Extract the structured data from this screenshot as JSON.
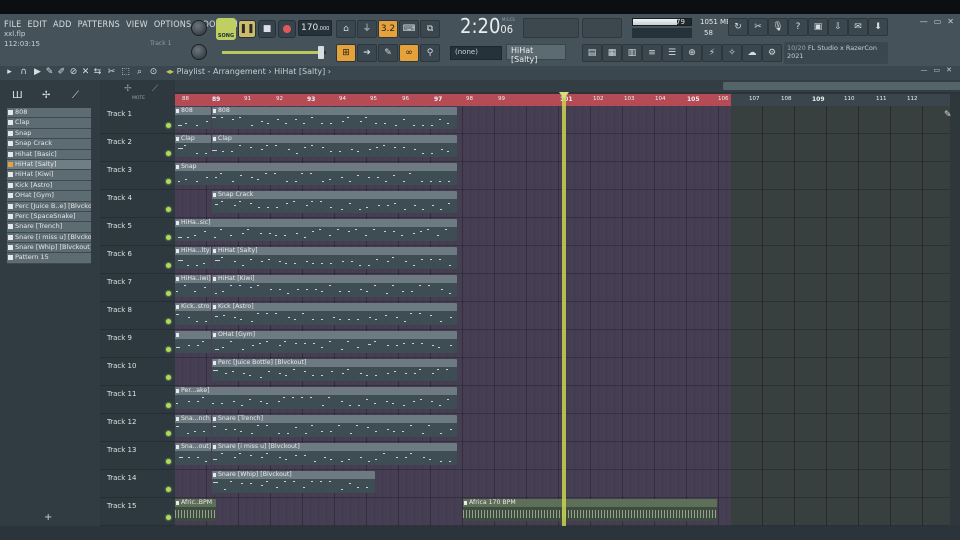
{
  "menu": [
    "FILE",
    "EDIT",
    "ADD",
    "PATTERNS",
    "VIEW",
    "OPTIONS",
    "TOOLS",
    "HELP"
  ],
  "project": {
    "filename": "xxl.flp",
    "time": "112:03:15",
    "hint": "Track 1"
  },
  "transport": {
    "mode": "SONG",
    "tempo": "170",
    "tempo_decimals": ".000",
    "time_main": "2:20",
    "time_sub": "06",
    "time_unit": "M:S:CS",
    "step": "3.2"
  },
  "monitor": {
    "cpu": "79",
    "memory": "1051 MB",
    "voices": "58",
    "cpu_level": 0.75
  },
  "news": {
    "count": "10/20",
    "title": "FL Studio x RazerCon",
    "year": "2021"
  },
  "toolbar": {
    "snap": "(none)",
    "pattern": "HiHat [Salty]"
  },
  "playlist": {
    "title": "Playlist - Arrangement",
    "pattern": "HiHat [Salty]",
    "snap_label": "MOTE"
  },
  "patterns": [
    "808",
    "Clap",
    "Snap",
    "Snap Crack",
    "Hihat [Basic]",
    "HiHat [Salty]",
    "HiHat [Kiwi]",
    "Kick [Astro]",
    "OHat [Gym]",
    "Perc [Juice B..e] [Blvckout]",
    "Perc [SpaceSnake]",
    "Snare [Trench]",
    "Snare [i miss u] [Blvckout]",
    "Snare [Whip] [Blvckout]",
    "Pattern 15"
  ],
  "selected_pattern": 5,
  "tracks": [
    "Track 1",
    "Track 2",
    "Track 3",
    "Track 4",
    "Track 5",
    "Track 6",
    "Track 7",
    "Track 8",
    "Track 9",
    "Track 10",
    "Track 11",
    "Track 12",
    "Track 13",
    "Track 14",
    "Track 15"
  ],
  "bars": [
    "88",
    "89",
    "91",
    "92",
    "93",
    "94",
    "95",
    "96",
    "97",
    "98",
    "99",
    "",
    "101",
    "102",
    "103",
    "104",
    "105",
    "106",
    "107",
    "108",
    "109",
    "110",
    "111",
    "112"
  ],
  "clips": [
    {
      "track": 0,
      "label": "808",
      "type": "pattern",
      "start": 0,
      "len": 36
    },
    {
      "track": 0,
      "label": "808",
      "type": "pattern",
      "start": 36,
      "len": 36
    },
    {
      "track": 0,
      "label": "808",
      "type": "pattern",
      "start": 72,
      "len": 36
    },
    {
      "track": 1,
      "label": "Clap",
      "type": "pattern",
      "start": 0,
      "len": 36
    },
    {
      "track": 1,
      "label": "Clap",
      "type": "pattern",
      "start": 36,
      "len": 36
    },
    {
      "track": 2,
      "label": "Snap",
      "type": "pattern",
      "start": 0,
      "len": 36
    },
    {
      "track": 3,
      "label": "Snap Crack",
      "type": "pattern",
      "start": 36,
      "len": 36
    },
    {
      "track": 3,
      "label": "Snap Crack",
      "type": "pattern",
      "start": 72,
      "len": 36
    },
    {
      "track": 4,
      "label": "HiHa..sic]",
      "type": "pattern",
      "start": 0,
      "len": 36
    },
    {
      "track": 5,
      "label": "HiHa...lty]",
      "type": "pattern",
      "start": 0,
      "len": 36
    },
    {
      "track": 5,
      "label": "HiHat [Salty]",
      "type": "pattern",
      "start": 36,
      "len": 36
    },
    {
      "track": 5,
      "label": "HiHat [Salty]",
      "type": "pattern",
      "start": 72,
      "len": 36
    },
    {
      "track": 6,
      "label": "HiHa..iwi]",
      "type": "pattern",
      "start": 0,
      "len": 36
    },
    {
      "track": 6,
      "label": "HiHat [Kiwi]",
      "type": "pattern",
      "start": 36,
      "len": 36
    },
    {
      "track": 6,
      "label": "HiHat [Kiwi]",
      "type": "pattern",
      "start": 72,
      "len": 36
    },
    {
      "track": 7,
      "label": "Kick..stro]",
      "type": "pattern",
      "start": 0,
      "len": 36
    },
    {
      "track": 7,
      "label": "Kick [Astro]",
      "type": "pattern",
      "start": 36,
      "len": 36
    },
    {
      "track": 7,
      "label": "Kick [Astro]",
      "type": "pattern",
      "start": 72,
      "len": 36
    },
    {
      "track": 8,
      "label": "",
      "type": "pattern",
      "start": 0,
      "len": 36
    },
    {
      "track": 8,
      "label": "OHat [Gym]",
      "type": "pattern",
      "start": 36,
      "len": 36
    },
    {
      "track": 8,
      "label": "OHat [Gym]",
      "type": "pattern",
      "start": 72,
      "len": 36
    },
    {
      "track": 9,
      "label": "Perc [Juice Bottle] [Blvckout]",
      "type": "pattern",
      "start": 36,
      "len": 36
    },
    {
      "track": 9,
      "label": "Perc [Juice Bottle] [Blvckout]",
      "type": "pattern",
      "start": 72,
      "len": 36
    },
    {
      "track": 10,
      "label": "Per...ake]",
      "type": "pattern",
      "start": 0,
      "len": 36
    },
    {
      "track": 11,
      "label": "Sna...nch]",
      "type": "pattern",
      "start": 0,
      "len": 36
    },
    {
      "track": 11,
      "label": "Snare [Trench]",
      "type": "pattern",
      "start": 36,
      "len": 36
    },
    {
      "track": 12,
      "label": "Sna...out]",
      "type": "pattern",
      "start": 0,
      "len": 36
    },
    {
      "track": 12,
      "label": "Snare [i miss u] [Blvckout]",
      "type": "pattern",
      "start": 36,
      "len": 36
    },
    {
      "track": 13,
      "label": "Snare [Whip] [Blvckout]",
      "type": "pattern",
      "start": 36,
      "len": 36
    },
    {
      "track": 14,
      "label": "Afric..BPM",
      "type": "audio",
      "start": 0,
      "len": 36
    },
    {
      "track": 14,
      "label": "Africa 170 BPM",
      "type": "audio",
      "start": 36,
      "len": 36
    },
    {
      "track": 14,
      "label": "Africa 170 BPM",
      "type": "audio",
      "start": 72,
      "len": 36
    }
  ],
  "colors": {
    "accent": "#b9c85a",
    "loop": "#b44b55",
    "grid": "#463f53",
    "playhead": "#c8d64e"
  }
}
